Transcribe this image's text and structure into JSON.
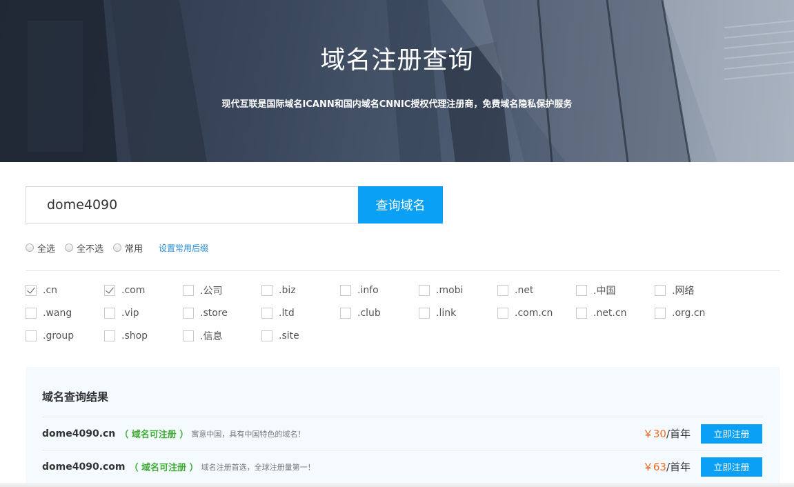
{
  "banner": {
    "title": "域名注册查询",
    "subtitle": "现代互联是国际域名ICANN和国内域名CNNIC授权代理注册商，免费域名隐私保护服务"
  },
  "search": {
    "value": "dome4090",
    "placeholder": "",
    "button_label": "查询域名"
  },
  "select_options": [
    {
      "label": "全选",
      "selected": false
    },
    {
      "label": "全不选",
      "selected": false
    },
    {
      "label": "常用",
      "selected": false
    }
  ],
  "set_common_link": "设置常用后缀",
  "suffixes": [
    {
      "label": ".cn",
      "checked": true
    },
    {
      "label": ".com",
      "checked": true
    },
    {
      "label": ".公司",
      "checked": false
    },
    {
      "label": ".biz",
      "checked": false
    },
    {
      "label": ".info",
      "checked": false
    },
    {
      "label": ".mobi",
      "checked": false
    },
    {
      "label": ".net",
      "checked": false
    },
    {
      "label": ".中国",
      "checked": false
    },
    {
      "label": ".网络",
      "checked": false
    },
    {
      "label": ".wang",
      "checked": false
    },
    {
      "label": ".vip",
      "checked": false
    },
    {
      "label": ".store",
      "checked": false
    },
    {
      "label": ".ltd",
      "checked": false
    },
    {
      "label": ".club",
      "checked": false
    },
    {
      "label": ".link",
      "checked": false
    },
    {
      "label": ".com.cn",
      "checked": false
    },
    {
      "label": ".net.cn",
      "checked": false
    },
    {
      "label": ".org.cn",
      "checked": false
    },
    {
      "label": ".group",
      "checked": false
    },
    {
      "label": ".shop",
      "checked": false
    },
    {
      "label": ".信息",
      "checked": false
    },
    {
      "label": ".site",
      "checked": false
    }
  ],
  "results": {
    "title": "域名查询结果",
    "rows": [
      {
        "domain": "dome4090.cn",
        "status": "（ 域名可注册 ）",
        "description": "寓意中国，具有中国特色的域名！",
        "price_symbol": "￥",
        "price_amount": "30",
        "price_unit": "/首年",
        "button_label": "立即注册"
      },
      {
        "domain": "dome4090.com",
        "status": "（ 域名可注册 ）",
        "description": "域名注册首选，全球注册量第一！",
        "price_symbol": "￥",
        "price_amount": "63",
        "price_unit": "/首年",
        "button_label": "立即注册"
      }
    ]
  },
  "colors": {
    "accent": "#0aa0f5",
    "available": "#3fab35",
    "price": "#f26b22",
    "link": "#2a8fd8"
  }
}
